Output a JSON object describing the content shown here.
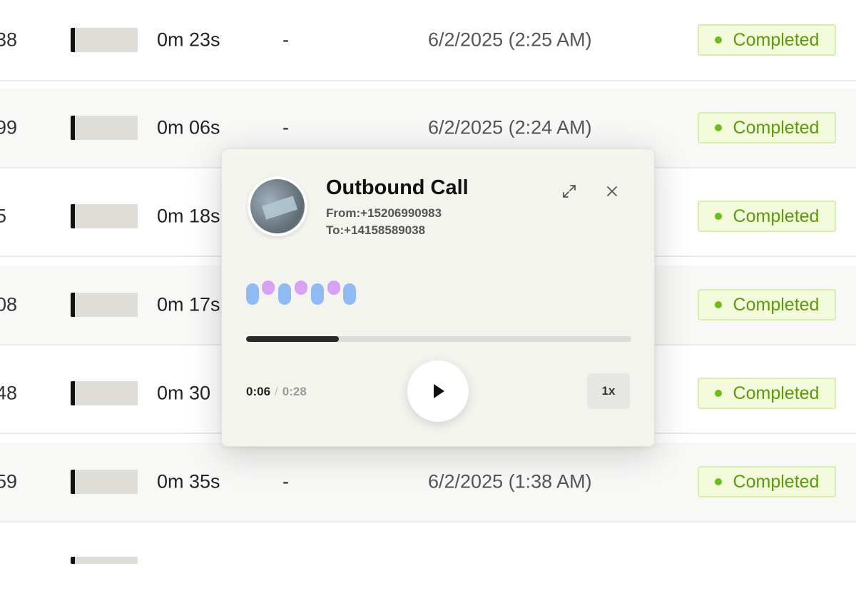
{
  "rows": [
    {
      "id": "38",
      "duration": "0m 23s",
      "dash": "-",
      "date": "6/2/2025 (2:25 AM)",
      "status": "Completed"
    },
    {
      "id": "99",
      "duration": "0m 06s",
      "dash": "-",
      "date": "6/2/2025 (2:24 AM)",
      "status": "Completed"
    },
    {
      "id": "5",
      "duration": "0m 18s",
      "dash": "",
      "date": "",
      "status": "Completed"
    },
    {
      "id": "08",
      "duration": "0m 17s",
      "dash": "",
      "date": "",
      "status": "Completed"
    },
    {
      "id": "48",
      "duration": "0m 30",
      "dash": "",
      "date": "",
      "status": "Completed"
    },
    {
      "id": "59",
      "duration": "0m 35s",
      "dash": "-",
      "date": "6/2/2025 (1:38 AM)",
      "status": "Completed"
    }
  ],
  "player": {
    "title": "Outbound Call",
    "from": "From:+15206990983",
    "to": "To:+14158589038",
    "current_time": "0:06",
    "separator": "/",
    "total_time": "0:28",
    "progress_fraction": 0.24,
    "speed": "1x"
  },
  "colors": {
    "badge_bg": "#f4fbdc",
    "badge_text": "#5a9a0d",
    "wave_blue": "#8fbaf4",
    "wave_purple": "#d6a3f4"
  },
  "icons": {
    "expand": "expand-icon",
    "close": "close-icon",
    "play": "play-icon"
  }
}
